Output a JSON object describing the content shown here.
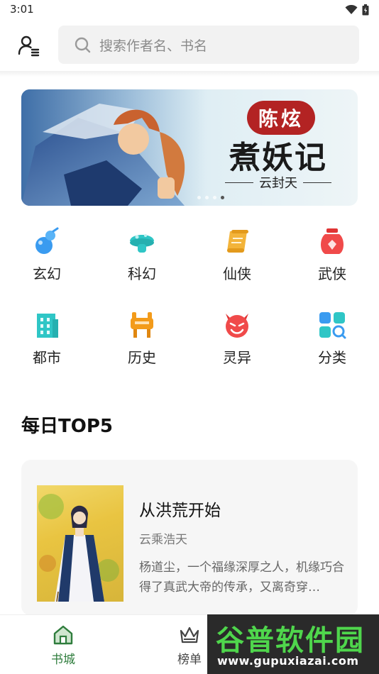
{
  "status_bar": {
    "time": "3:01"
  },
  "header": {
    "search_placeholder": "搜索作者名、书名"
  },
  "banner": {
    "seal_text": "陈炫",
    "title": "煮妖记",
    "author": "云封天",
    "slide_count": 4,
    "active_slide": 3
  },
  "categories": [
    {
      "label": "玄幻",
      "icon": "gourd-icon",
      "color": "#3a9bf0"
    },
    {
      "label": "科幻",
      "icon": "mushroom-icon",
      "color": "#2fc6c6"
    },
    {
      "label": "仙侠",
      "icon": "scroll-icon",
      "color": "#f3b43a"
    },
    {
      "label": "武侠",
      "icon": "wine-jar-icon",
      "color": "#f04a4a"
    },
    {
      "label": "都市",
      "icon": "building-icon",
      "color": "#2fc6c6"
    },
    {
      "label": "历史",
      "icon": "ding-vessel-icon",
      "color": "#f39b1a"
    },
    {
      "label": "灵异",
      "icon": "devil-icon",
      "color": "#f04a4a"
    },
    {
      "label": "分类",
      "icon": "category-search-icon",
      "color": "#3a9bf0"
    }
  ],
  "daily_top": {
    "title": "每日TOP5",
    "book": {
      "title": "从洪荒开始",
      "author": "云乘浩天",
      "description": "杨道尘，一个福缘深厚之人，机缘巧合得了真武大帝的传承，又离奇穿…"
    }
  },
  "tab_bar": {
    "tabs": [
      {
        "label": "书城",
        "icon": "home-icon",
        "active": true
      },
      {
        "label": "榜单",
        "icon": "crown-icon",
        "active": false
      }
    ]
  },
  "watermark": {
    "text": "谷普软件园",
    "url": "www.gupuxiazai.com"
  },
  "colors": {
    "accent": "#2f7d3d",
    "search_bg": "#f2f2f2"
  }
}
